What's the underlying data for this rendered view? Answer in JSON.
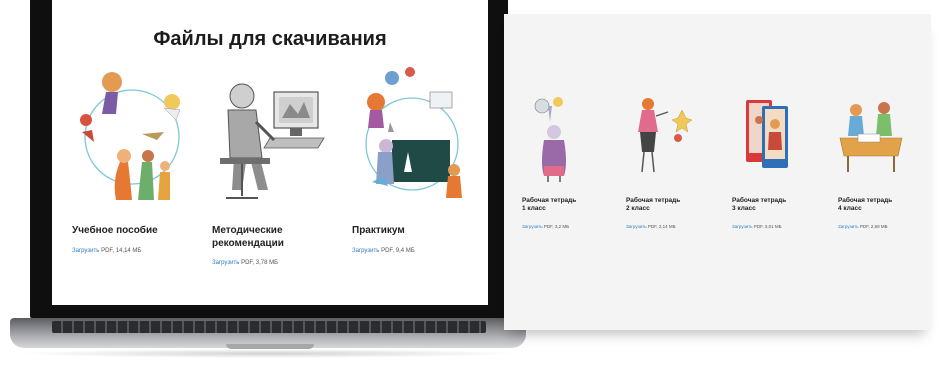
{
  "laptop_page": {
    "title": "Файлы для скачивания",
    "items": [
      {
        "title_line1": "Учебное пособие",
        "title_line2": "",
        "link": "Загрузить",
        "meta": "PDF, 14,14 МБ"
      },
      {
        "title_line1": "Методические",
        "title_line2": "рекомендации",
        "link": "Загрузить",
        "meta": "PDF, 3,78 МБ"
      },
      {
        "title_line1": "Практикум",
        "title_line2": "",
        "link": "Загрузить",
        "meta": "PDF, 9,4 МБ"
      }
    ]
  },
  "card_page": {
    "items": [
      {
        "title_line1": "Рабочая тетрадь",
        "title_line2": "1 класс",
        "link": "Загрузить",
        "meta": "PDF, 3,2 МБ"
      },
      {
        "title_line1": "Рабочая тетрадь",
        "title_line2": "2 класс",
        "link": "Загрузить",
        "meta": "PDF, 2,14 МБ"
      },
      {
        "title_line1": "Рабочая тетрадь",
        "title_line2": "3 класс",
        "link": "Загрузить",
        "meta": "PDF, 3,01 МБ"
      },
      {
        "title_line1": "Рабочая тетрадь",
        "title_line2": "4 класс",
        "link": "Загрузить",
        "meta": "PDF, 2,69 МБ"
      }
    ]
  },
  "colors": {
    "link": "#2d7fc1",
    "text": "#222222",
    "bezel": "#0f0f10"
  },
  "icons": [
    "textbook-illustration",
    "teacher-at-computer-illustration",
    "workshop-illustration",
    "workbook-1-illustration",
    "workbook-2-illustration",
    "workbook-3-illustration",
    "workbook-4-illustration"
  ]
}
